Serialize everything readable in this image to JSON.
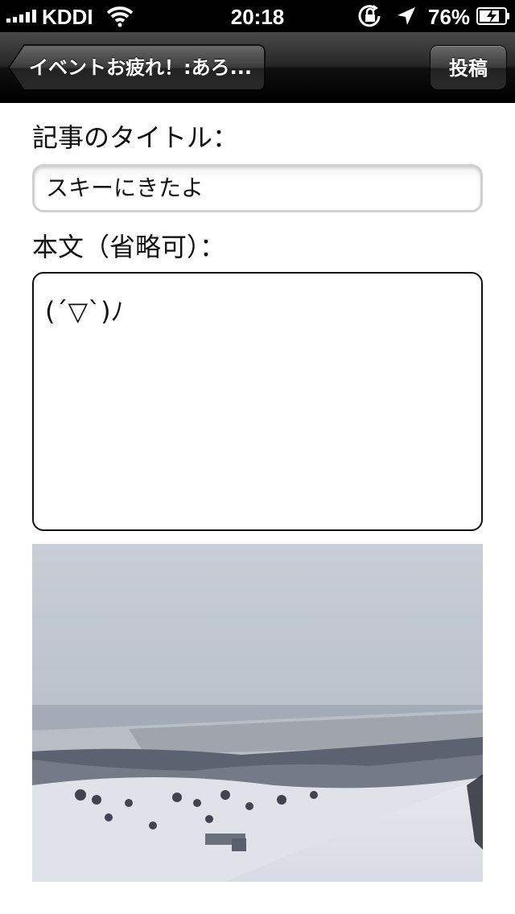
{
  "status_bar": {
    "carrier": "KDDI",
    "time": "20:18",
    "battery_percent": "76%",
    "icons": [
      "signal-bars-icon",
      "wifi-icon",
      "rotation-lock-icon",
      "location-arrow-icon",
      "battery-charging-icon"
    ]
  },
  "nav": {
    "back_label": "イベントお疲れ！:あろ...",
    "post_label": "投稿"
  },
  "form": {
    "title_label": "記事のタイトル：",
    "title_value": "スキーにきたよ",
    "body_label": "本文（省略可）：",
    "body_value": "(´▽`)ﾉ"
  },
  "colors": {
    "nav_bar": "#1a1a1a",
    "background": "#ffffff"
  }
}
